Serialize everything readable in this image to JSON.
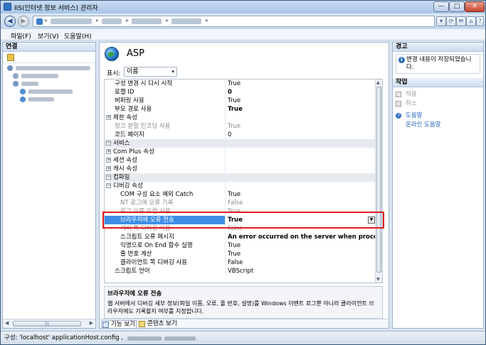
{
  "window": {
    "title": "IIS(인터넷 정보 서비스) 관리자",
    "min_label": "—",
    "max_label": "□",
    "close_label": "✕"
  },
  "addressbar": {
    "back_glyph": "◀",
    "forward_glyph": "▶",
    "toolbar_icons": [
      "▾",
      "⟳",
      "✉",
      "⌂",
      "?",
      "▾"
    ]
  },
  "menu": {
    "items": [
      "파일(F)",
      "보기(V)",
      "도움말(H)"
    ]
  },
  "connections": {
    "header": "연결"
  },
  "main": {
    "title": "ASP",
    "display_label": "표시:",
    "display_value": "이름",
    "grid_rows": [
      {
        "name": "구성 변경 시 다시 시작",
        "value": "True",
        "kind": "sub"
      },
      {
        "name": "로캘 ID",
        "value": "0",
        "kind": "sub bold"
      },
      {
        "name": "버퍼링 사용",
        "value": "True",
        "kind": "sub"
      },
      {
        "name": "부모 경로 사용",
        "value": "True",
        "kind": "sub bold"
      },
      {
        "name": "제한 속성",
        "value": "",
        "kind": "plus"
      },
      {
        "name": "정크 분할 인코딩 사용",
        "value": "True",
        "kind": "sub dim"
      },
      {
        "name": "코드 페이지",
        "value": "0",
        "kind": "sub"
      },
      {
        "name": "서비스",
        "value": "",
        "kind": "cat"
      },
      {
        "name": "Com Plus 속성",
        "value": "",
        "kind": "plus"
      },
      {
        "name": "세션 속성",
        "value": "",
        "kind": "plus"
      },
      {
        "name": "캐시 속성",
        "value": "",
        "kind": "plus"
      },
      {
        "name": "컴파일",
        "value": "",
        "kind": "cat"
      },
      {
        "name": "디버깅 속성",
        "value": "",
        "kind": "minus"
      },
      {
        "name": "COM 구성 요소 예외 Catch",
        "value": "True",
        "kind": "sub2"
      },
      {
        "name": "NT 로그에 오류 기록",
        "value": "False",
        "kind": "sub2 dim"
      },
      {
        "name": "로그 오류 요청 사용",
        "value": "True",
        "kind": "sub2 dim"
      },
      {
        "name": "브라우저에 오류 전송",
        "value": "True",
        "kind": "sub2 selected"
      },
      {
        "name": "서버 쪽 디버깅 사용",
        "value": "False",
        "kind": "sub2 dim"
      },
      {
        "name": "스크립트 오류 메시지",
        "value": "An error occurred on the server when processing the UR",
        "kind": "sub2 bold"
      },
      {
        "name": "익명으로 On End 함수 실행",
        "value": "True",
        "kind": "sub2"
      },
      {
        "name": "줄 번호 계산",
        "value": "True",
        "kind": "sub2"
      },
      {
        "name": "클라이언트 쪽 디버깅 사용",
        "value": "False",
        "kind": "sub2"
      },
      {
        "name": "스크립트 언어",
        "value": "VBScript",
        "kind": "sub"
      }
    ],
    "description_title": "브라우저에 오류 전송",
    "description_text": "웹 서버에서 디버깅 세부 정보(파일 이름, 오류, 줄 번호, 설명)를 Windows 이벤트 로그뿐 아니라 클라이언트 브라우저에도 기록할지 여부를 지정합니다.",
    "tabs": [
      "기능 보기",
      "콘텐츠 보기"
    ]
  },
  "right": {
    "alerts_header": "경고",
    "alert_text": "변경 내용이 저장되었습니다.",
    "actions_header": "작업",
    "actions": [
      {
        "label": "적용",
        "kind": "disabled"
      },
      {
        "label": "취소",
        "kind": "disabled"
      },
      {
        "label": "도움말",
        "kind": "link"
      },
      {
        "label": "온라인 도움말",
        "kind": "link"
      }
    ]
  },
  "status": {
    "text": "구성: 'localhost' applicationHost.config ,"
  },
  "colors": {
    "selection": "#3d8ee5",
    "highlight_border": "#e21c1c",
    "link": "#1f5fb3"
  }
}
